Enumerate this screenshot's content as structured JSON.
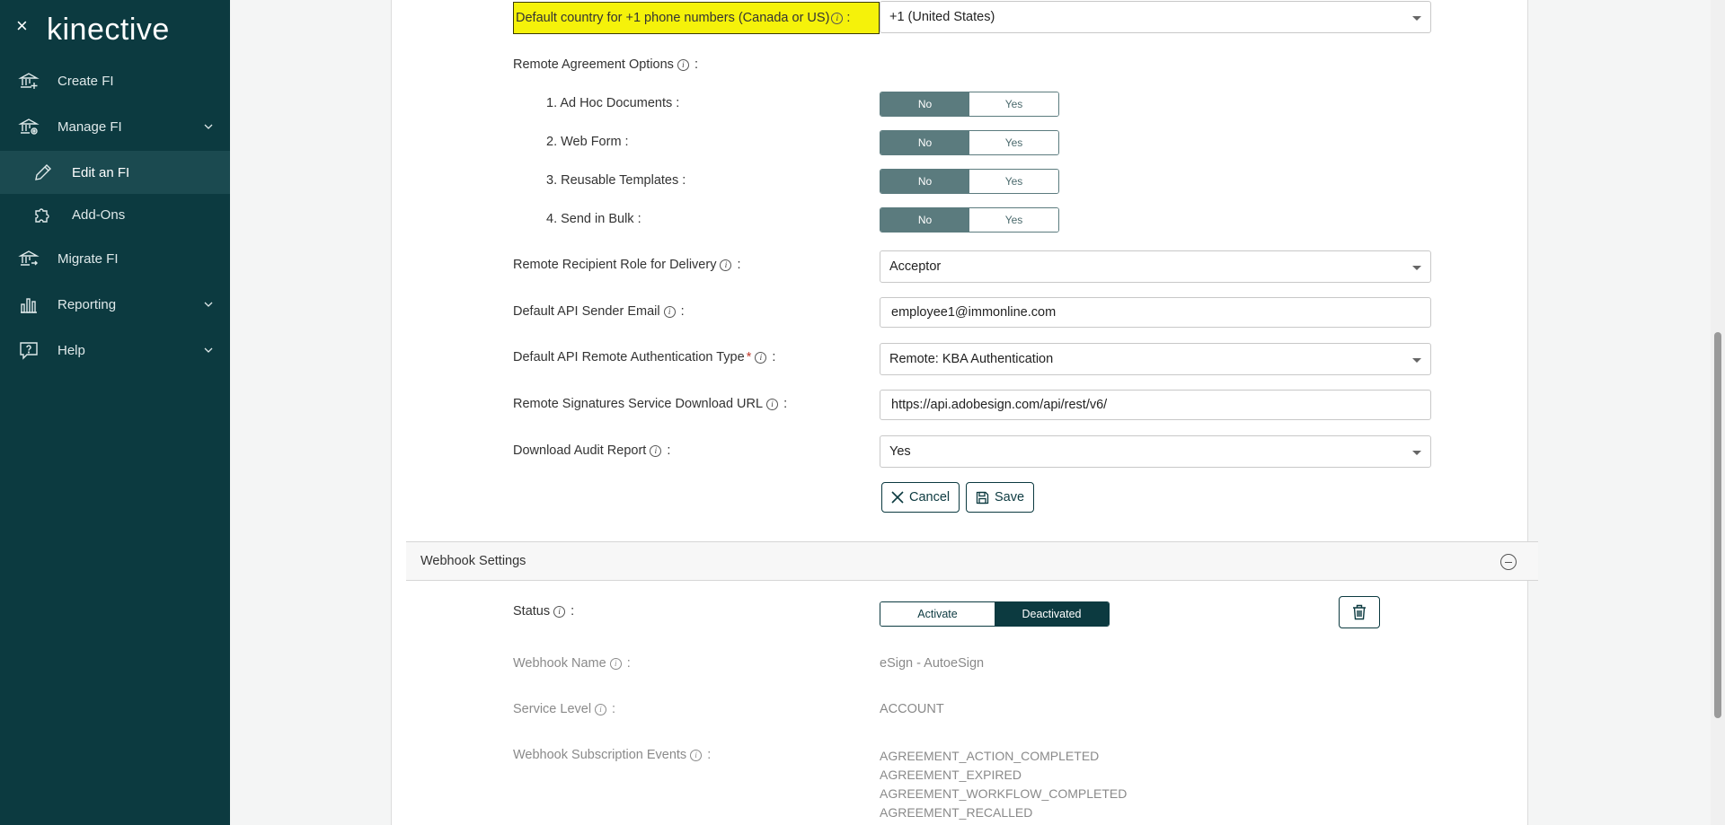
{
  "sidebar": {
    "logo": "kinective",
    "close_glyph": "×",
    "items": [
      {
        "label": "Create FI",
        "icon": "bank-plus-icon"
      },
      {
        "label": "Manage FI",
        "icon": "bank-gear-icon"
      },
      {
        "label": "Edit an FI",
        "icon": "pencil-icon"
      },
      {
        "label": "Add-Ons",
        "icon": "puzzle-icon"
      },
      {
        "label": "Migrate FI",
        "icon": "bank-migrate-icon"
      },
      {
        "label": "Reporting",
        "icon": "bar-chart-icon"
      },
      {
        "label": "Help",
        "icon": "help-bubble-icon"
      }
    ]
  },
  "form": {
    "default_country_label": "Default country for +1 phone numbers (Canada or US)",
    "default_country_value": "+1 (United States)",
    "remote_options_label": "Remote Agreement Options",
    "options": [
      {
        "label": "1. Ad Hoc Documents :",
        "selected": "No"
      },
      {
        "label": "2. Web Form :",
        "selected": "No"
      },
      {
        "label": "3. Reusable Templates :",
        "selected": "No"
      },
      {
        "label": "4. Send in Bulk :",
        "selected": "No"
      }
    ],
    "no_label": "No",
    "yes_label": "Yes",
    "recipient_role_label": "Remote Recipient Role for Delivery",
    "recipient_role_value": "Acceptor",
    "sender_email_label": "Default API Sender Email",
    "sender_email_value": "employee1@immonline.com",
    "auth_type_label": "Default API Remote Authentication Type",
    "auth_type_value": "Remote: KBA Authentication",
    "download_url_label": "Remote Signatures Service Download URL",
    "download_url_value": "https://api.adobesign.com/api/rest/v6/",
    "audit_report_label": "Download Audit Report",
    "audit_report_value": "Yes",
    "colon": ":",
    "required_mark": "*",
    "info_glyph": "i",
    "cancel_label": "Cancel",
    "save_label": "Save"
  },
  "webhook": {
    "section_title": "Webhook Settings",
    "status_label": "Status",
    "activate_label": "Activate",
    "deactivated_label": "Deactivated",
    "name_label": "Webhook Name",
    "name_value": "eSign - AutoeSign",
    "service_level_label": "Service Level",
    "service_level_value": "ACCOUNT",
    "events_label": "Webhook Subscription Events",
    "events": [
      "AGREEMENT_ACTION_COMPLETED",
      "AGREEMENT_EXPIRED",
      "AGREEMENT_WORKFLOW_COMPLETED",
      "AGREEMENT_RECALLED"
    ]
  },
  "colors": {
    "sidebar_bg": "#0c3a40",
    "toggle_on": "#5b7b7e",
    "highlight": "#f5f20a"
  }
}
